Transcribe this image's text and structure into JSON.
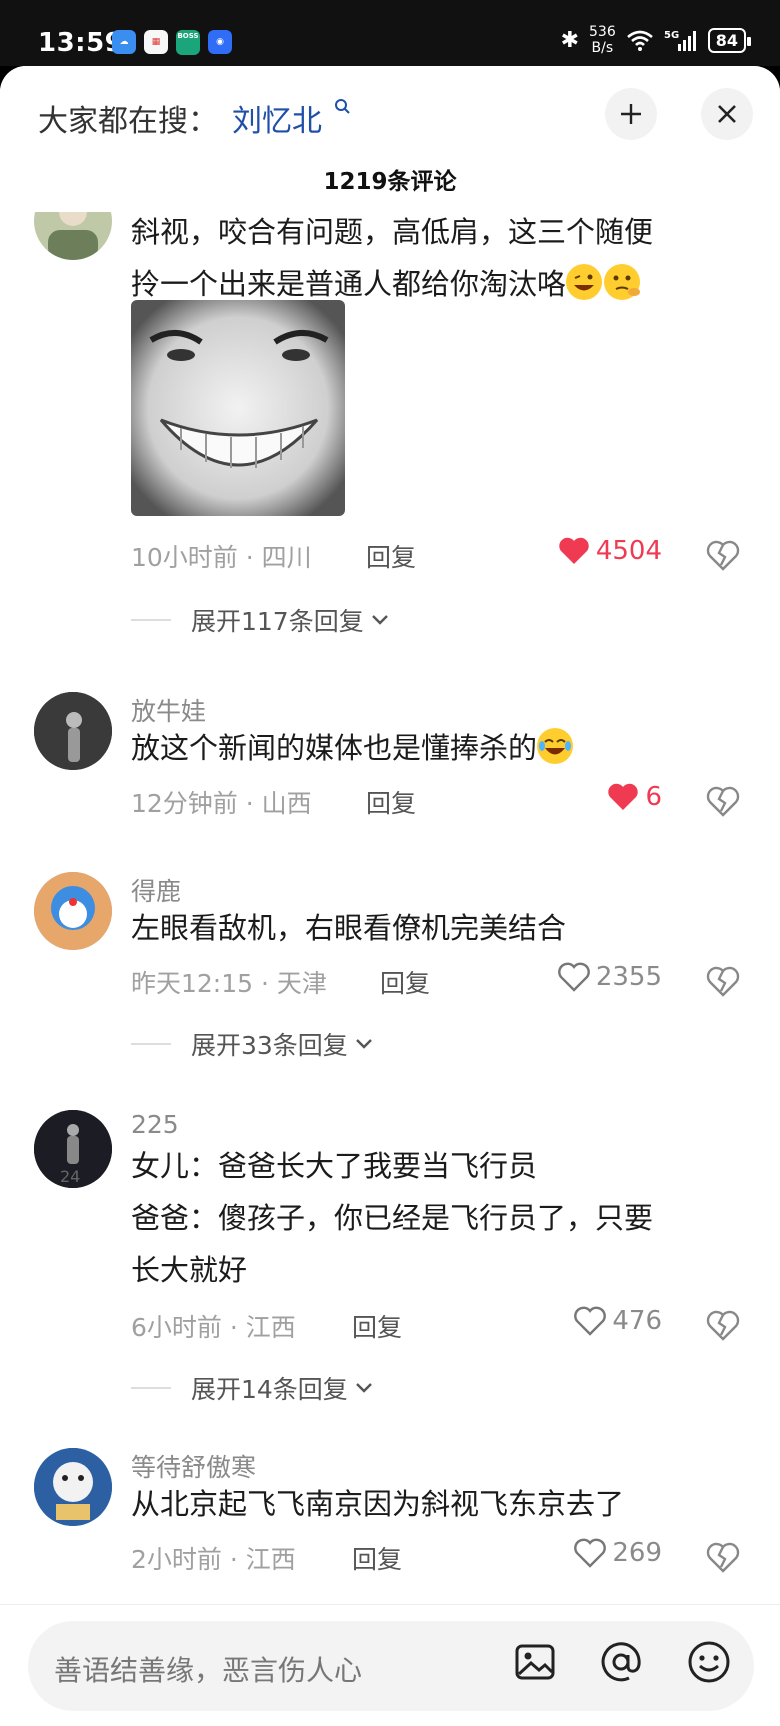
{
  "status": {
    "time": "13:59",
    "net_speed_value": "536",
    "net_speed_unit": "B/s",
    "signal": "5G",
    "battery": "84",
    "apps": [
      "weather",
      "calendar",
      "boss",
      "browser"
    ],
    "boss_label": "BOSS\n直聘"
  },
  "header": {
    "search_prefix": "大家都在搜：",
    "search_term": "刘忆北",
    "comment_count": "1219条评论"
  },
  "comments": [
    {
      "text_lines": [
        "斜视，咬合有问题，高低肩，这三个随便",
        "拎一个出来是普通人都给你淘汰咯"
      ],
      "emojis": [
        "grin-wink",
        "thinking"
      ],
      "has_image": true,
      "time": "10小时前",
      "location": "四川",
      "reply": "回复",
      "likes": "4504",
      "liked": true,
      "expand": "展开117条回复"
    },
    {
      "username": "放牛娃",
      "text": "放这个新闻的媒体也是懂捧杀的",
      "emoji": "laugh-cry",
      "time": "12分钟前",
      "location": "山西",
      "reply": "回复",
      "likes": "6",
      "liked": true
    },
    {
      "username": "得鹿",
      "text": "左眼看敌机，右眼看僚机完美结合",
      "time": "昨天12:15",
      "location": "天津",
      "reply": "回复",
      "likes": "2355",
      "liked": false,
      "expand": "展开33条回复"
    },
    {
      "username": "225",
      "text_lines": [
        "女儿：爸爸长大了我要当飞行员",
        "爸爸：傻孩子，你已经是飞行员了，只要",
        "长大就好"
      ],
      "time": "6小时前",
      "location": "江西",
      "reply": "回复",
      "likes": "476",
      "liked": false,
      "expand": "展开14条回复"
    },
    {
      "username": "等待舒傲寒",
      "text": "从北京起飞飞南京因为斜视飞东京去了",
      "time": "2小时前",
      "location": "江西",
      "reply": "回复",
      "likes": "269",
      "liked": false
    }
  ],
  "bottom": {
    "placeholder": "善语结善缘，恶言伤人心",
    "icons": [
      "image-icon",
      "at-icon",
      "emoji-icon"
    ]
  },
  "colors": {
    "like_red": "#ef3a52",
    "link_blue": "#1f4fa8"
  }
}
